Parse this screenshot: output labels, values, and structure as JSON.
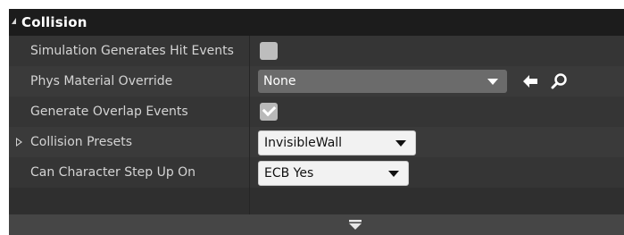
{
  "section": {
    "title": "Collision"
  },
  "rows": [
    {
      "label": "Simulation Generates Hit Events",
      "control": "checkbox",
      "checked": false
    },
    {
      "label": "Phys Material Override",
      "control": "combo",
      "value": "None"
    },
    {
      "label": "Generate Overlap Events",
      "control": "checkbox",
      "checked": true
    },
    {
      "label": "Collision Presets",
      "control": "combo",
      "value": "InvisibleWall"
    },
    {
      "label": "Can Character Step Up On",
      "control": "combo",
      "value": "ECB Yes"
    }
  ],
  "icons": {
    "header_toggle": "collapse-triangle-icon",
    "expand": "expand-triangle-icon",
    "use_selected": "arrow-left-icon",
    "browse": "search-icon",
    "combo_arrow": "chevron-down-icon",
    "footer_expand": "expand-more-icon"
  },
  "colors": {
    "panel_bg": "#2f2f2f",
    "header_bg": "#1c1c1c",
    "row_bg": "#353535",
    "text": "#d4d4d4"
  }
}
